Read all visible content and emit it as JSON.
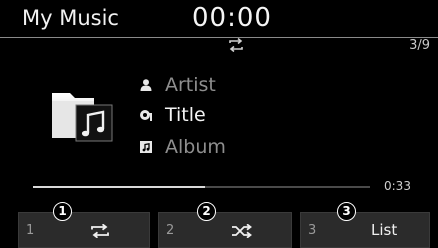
{
  "header": {
    "app_title": "My Music",
    "clock": "00:00"
  },
  "status": {
    "repeat_icon": "repeat-icon",
    "track_count": "3/9"
  },
  "album_art": {
    "icon": "music-folder-icon"
  },
  "track": {
    "artist": "Artist",
    "title": "Title",
    "album": "Album",
    "artist_icon": "person-icon",
    "title_icon": "song-title-icon",
    "album_icon": "album-icon"
  },
  "progress": {
    "fraction": 0.51,
    "elapsed": "0:33"
  },
  "buttons": [
    {
      "number": "1",
      "icon": "repeat-icon",
      "callout": "1"
    },
    {
      "number": "2",
      "icon": "shuffle-icon",
      "callout": "2"
    },
    {
      "number": "3",
      "label": "List",
      "callout": "3"
    }
  ],
  "colors": {
    "background": "#000000",
    "button_bg": "#2b2b2b",
    "text_primary": "#f4f4f4",
    "text_dim": "#8e8e8e"
  }
}
